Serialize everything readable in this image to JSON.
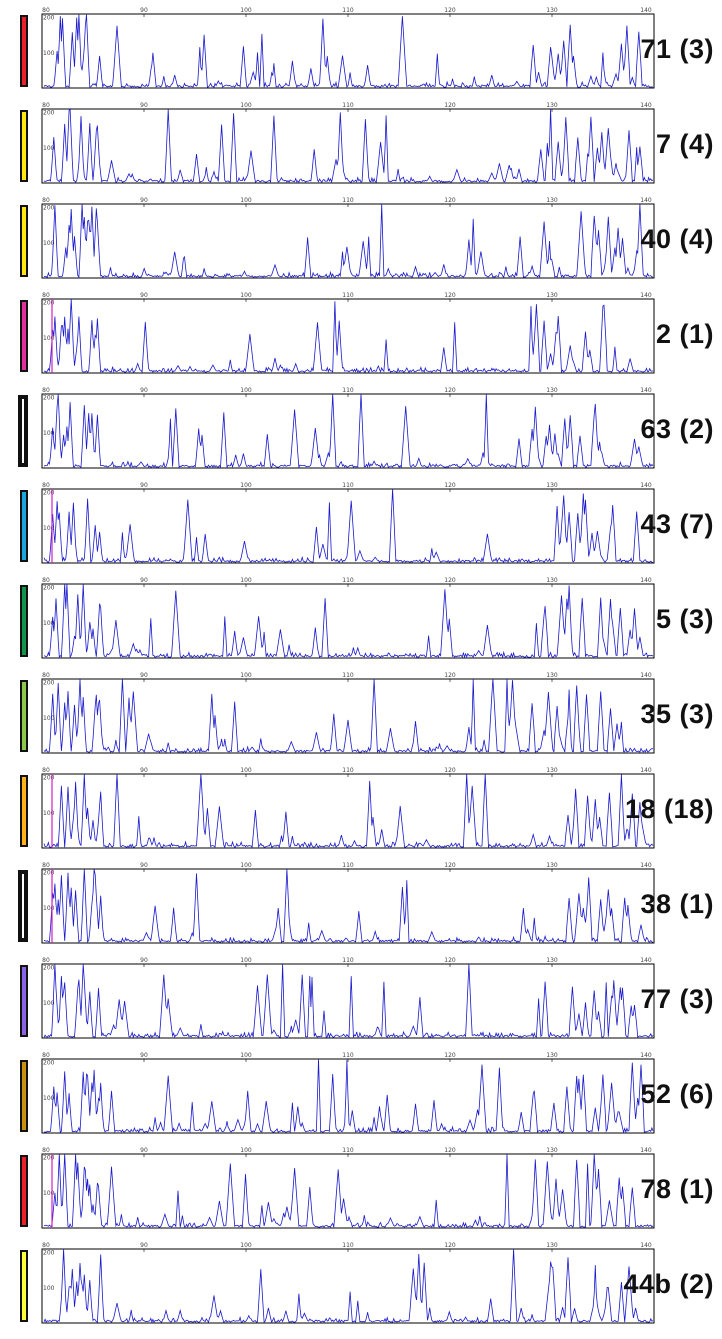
{
  "figure": {
    "panels": [
      {
        "label": "71 (3)",
        "color": "#e8202a",
        "style": "filled"
      },
      {
        "label": "7 (4)",
        "color": "#ffe614",
        "style": "filled"
      },
      {
        "label": "40 (4)",
        "color": "#ffe614",
        "style": "filled"
      },
      {
        "label": "2 (1)",
        "color": "#e0309a",
        "style": "filled"
      },
      {
        "label": "63 (2)",
        "color": "#ffffff",
        "style": "hollow"
      },
      {
        "label": "43 (7)",
        "color": "#1ba6e0",
        "style": "filled"
      },
      {
        "label": "5 (3)",
        "color": "#12954a",
        "style": "filled"
      },
      {
        "label": "35 (3)",
        "color": "#8cc84b",
        "style": "filled"
      },
      {
        "label": "18 (18)",
        "color": "#ffb21a",
        "style": "filled"
      },
      {
        "label": "38 (1)",
        "color": "#ffffff",
        "style": "hollow"
      },
      {
        "label": "77 (3)",
        "color": "#8c62e6",
        "style": "filled"
      },
      {
        "label": "52 (6)",
        "color": "#c7930f",
        "style": "filled"
      },
      {
        "label": "78 (1)",
        "color": "#e8202a",
        "style": "filled"
      },
      {
        "label": "44b (2)",
        "color": "#ffff3c",
        "style": "filled"
      }
    ]
  },
  "chart_data": {
    "type": "line",
    "x_ticks": [
      "80",
      "90",
      "100",
      "110",
      "120",
      "130",
      "140"
    ],
    "y_ticks": [
      "100",
      "200"
    ],
    "xlim": [
      80,
      140
    ],
    "ylim": [
      0,
      210
    ],
    "line_color": "#1a1acc",
    "series_count": 14
  }
}
